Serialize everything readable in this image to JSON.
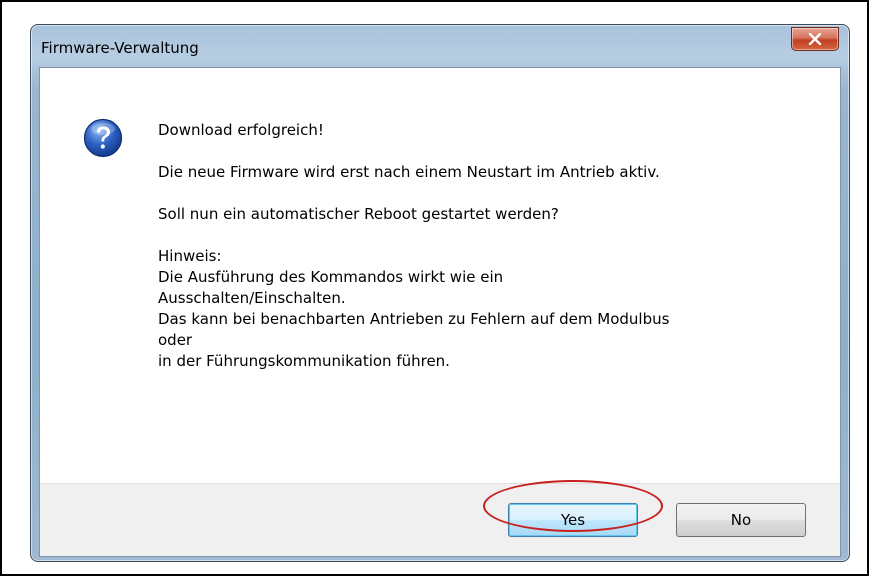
{
  "dialog": {
    "title": "Firmware-Verwaltung",
    "icon": "question-icon",
    "message_lines": [
      "Download erfolgreich!",
      "",
      "Die neue Firmware wird erst nach einem Neustart im Antrieb aktiv.",
      "",
      "Soll nun ein automatischer Reboot gestartet werden?",
      "",
      "Hinweis:",
      "Die Ausführung des Kommandos wirkt wie ein",
      "Ausschalten/Einschalten.",
      "Das kann bei benachbarten Antrieben zu Fehlern auf dem Modulbus",
      "oder",
      "in der Führungskommunikation führen."
    ],
    "buttons": {
      "yes_label": "Yes",
      "no_label": "No"
    }
  },
  "colors": {
    "highlight_ellipse": "#c8201e",
    "close_button": "#c23e22",
    "default_button_border": "#3c7fb1"
  }
}
